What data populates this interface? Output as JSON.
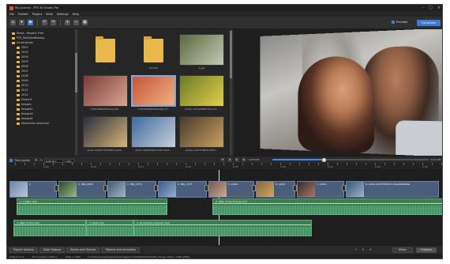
{
  "window": {
    "title": "My journey - PTE AV Studio Pro"
  },
  "menu": [
    "File",
    "Publish",
    "Project",
    "Slide",
    "Settings",
    "Help"
  ],
  "toolbar": {
    "preview_label": "Preview",
    "fullscreen_label": "Full screen"
  },
  "tree": {
    "items": [
      {
        "label": "Music - Royalty Free",
        "level": 0
      },
      {
        "label": "PTE_PenDriveBackup",
        "level": 0
      },
      {
        "label": "Screenshots",
        "level": 0
      },
      {
        "label": "2002",
        "level": 1
      },
      {
        "label": "2003",
        "level": 1
      },
      {
        "label": "2004",
        "level": 1
      },
      {
        "label": "2005",
        "level": 1
      },
      {
        "label": "2006",
        "level": 1
      },
      {
        "label": "2007",
        "level": 1
      },
      {
        "label": "2008",
        "level": 1
      },
      {
        "label": "2009",
        "level": 1
      },
      {
        "label": "2010",
        "level": 1
      },
      {
        "label": "2011",
        "level": 1
      },
      {
        "label": "2012",
        "level": 1
      },
      {
        "label": "Demo 6",
        "level": 1
      },
      {
        "label": "Images",
        "level": 1
      },
      {
        "label": "Images2",
        "level": 1
      },
      {
        "label": "Images3",
        "level": 1
      },
      {
        "label": "Images4",
        "level": 1
      },
      {
        "label": "Mountains resources",
        "level": 1
      }
    ]
  },
  "grid": {
    "items": [
      {
        "caption": "..",
        "kind": "folder"
      },
      {
        "caption": "Portrait",
        "kind": "folder"
      },
      {
        "caption": "1.jpg",
        "kind": "photo",
        "colors": [
          "#5b6a3e",
          "#c4c8b4"
        ]
      },
      {
        "caption": "c7c8c8d6ef0f3e0ad_f0C...",
        "kind": "photo",
        "colors": [
          "#7a3a3a",
          "#d9a590"
        ]
      },
      {
        "caption": "c7c8c8d6ef0f3e0ad6d_f3...",
        "kind": "photo",
        "colors": [
          "#c4563a",
          "#f0b080"
        ],
        "selected": true
      },
      {
        "caption": "photo-1472158657874-10...",
        "kind": "photo",
        "colors": [
          "#6a7a2a",
          "#e2d04a"
        ]
      },
      {
        "caption": "photo-1430776700651-aa0b...",
        "kind": "photo",
        "colors": [
          "#2a2f3c",
          "#d8b478"
        ]
      },
      {
        "caption": "photo-1454546117694-16cb...",
        "kind": "photo",
        "colors": [
          "#3e6aa0",
          "#c8d0d8"
        ]
      },
      {
        "caption": "photo-1447178849-05b5...",
        "kind": "photo",
        "colors": [
          "#4a3a2a",
          "#c9a064"
        ]
      }
    ]
  },
  "playbar": {
    "timeline_label": "Time points",
    "time_field": "0:05.517",
    "add_label": "Add",
    "current_time": "0:05.525",
    "total_time": "3:15.100"
  },
  "ruler": {
    "labels": [
      "0:05",
      "0:10",
      "0:15",
      "0:20",
      "0:25",
      "0:30",
      "0:35",
      "0:40",
      "0:45"
    ]
  },
  "slides": [
    {
      "caption": "1",
      "colors": [
        "#6c88a8",
        "#b8c8d8"
      ]
    },
    {
      "caption": "2. IMG_0059",
      "colors": [
        "#2b4a2b",
        "#9ab68a"
      ]
    },
    {
      "caption": "3. IMG_1574",
      "colors": [
        "#445a78",
        "#a6b6c6"
      ]
    },
    {
      "caption": "4. IMG_1575",
      "colors": [
        "#3a5a8a",
        "#96b0d0"
      ]
    },
    {
      "caption": "5. photo",
      "colors": [
        "#7a5a4a",
        "#c8a896"
      ]
    },
    {
      "caption": "6. photo",
      "colors": [
        "#8a6a3a",
        "#d0a468"
      ]
    },
    {
      "caption": "7. photo",
      "colors": [
        "#3a2a2a",
        "#a87868"
      ]
    },
    {
      "caption": "8. photo-1453730035-c1bed0b8e60a",
      "colors": [
        "#3a5a7a",
        "#98b4c8"
      ]
    }
  ],
  "audio": [
    {
      "caption": "1. A Walk mp3"
    },
    {
      "caption": "2. Walk of the Flames mp3"
    },
    {
      "caption": "3. Walk of fire mp3"
    },
    {
      "caption": "4. Flute mp3"
    },
    {
      "caption": "5. Borderline (original) mp3"
    }
  ],
  "bottom": {
    "tabs": [
      "Project Options",
      "Slide Options",
      "Styles and Themes",
      "Objects and Animation"
    ],
    "modes": [
      "Slides",
      "Timeline"
    ]
  },
  "status": {
    "slide": "Slide 5 of 11",
    "duration": "Full duration: 5.862 s",
    "size": "1920 x 1280",
    "path": "D:\\Slideshows\\Screenshots\\Images\\c7c8c8d6ef0f3e0ad6d_f30.jpg 1920 x 1280 (JPEG)"
  },
  "colors": {
    "accent": "#3d7bd9",
    "audio": "#3c7d53",
    "slide": "#4a5d7a"
  }
}
